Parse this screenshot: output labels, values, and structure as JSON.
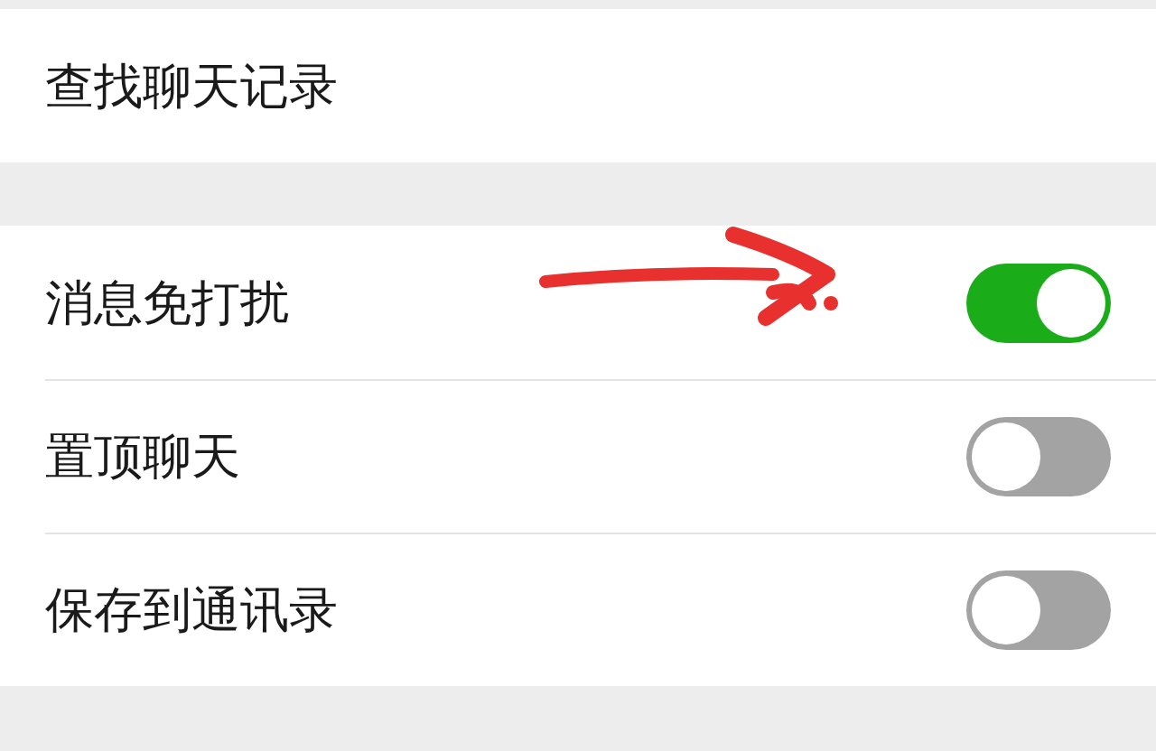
{
  "search_row": {
    "label": "查找聊天记录"
  },
  "settings": [
    {
      "label": "消息免打扰",
      "on": true
    },
    {
      "label": "置顶聊天",
      "on": false
    },
    {
      "label": "保存到通讯录",
      "on": false
    }
  ]
}
